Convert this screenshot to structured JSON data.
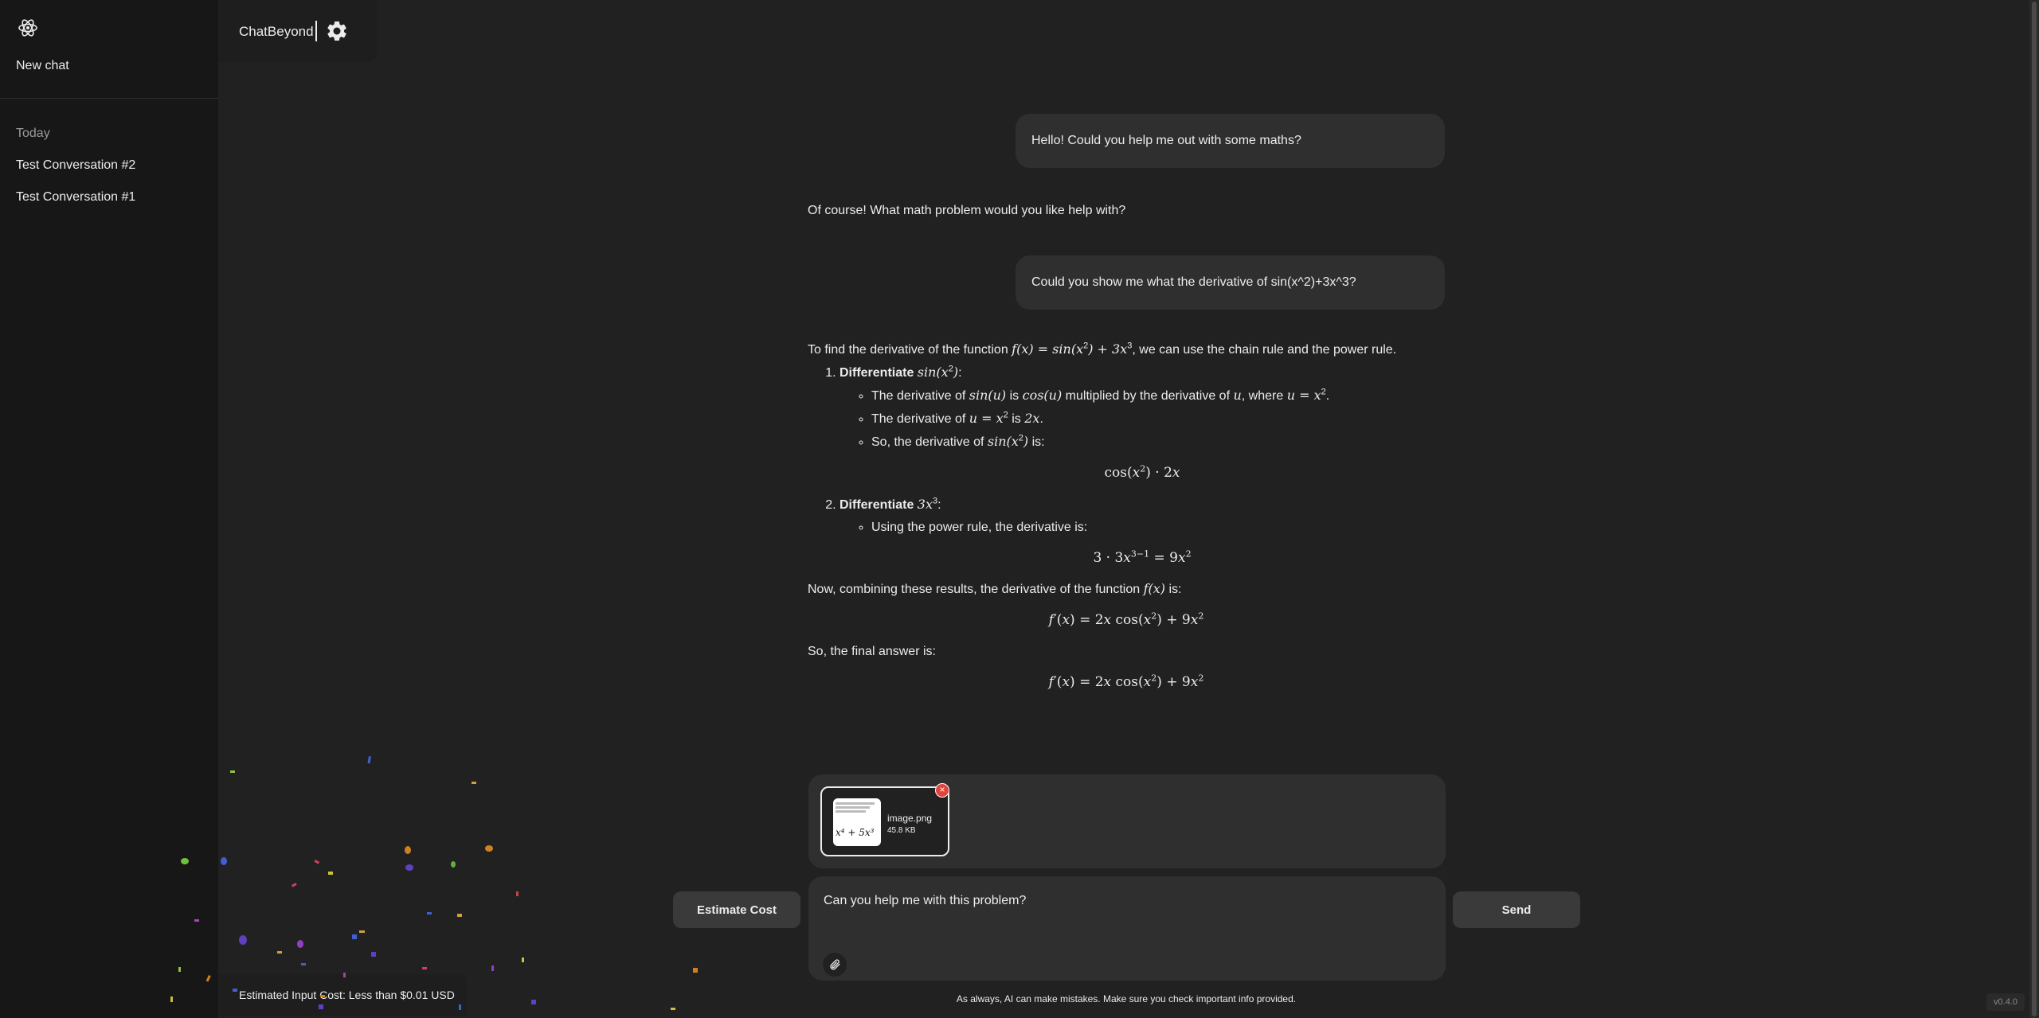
{
  "sidebar": {
    "logo_icon": "atom-icon",
    "new_chat_label": "New chat",
    "section_today": "Today",
    "conversations": [
      "Test Conversation #2",
      "Test Conversation #1"
    ]
  },
  "topbar": {
    "title": "ChatBeyond",
    "settings_icon": "gear-icon"
  },
  "messages": {
    "user_1": "Hello! Could you help me out with some maths?",
    "assistant_1": "Of course! What math problem would you like help with?",
    "user_2": "Could you show me what the derivative of sin(x^2)+3x^3?",
    "assistant_2": {
      "intro_a": "To find the derivative of the function ",
      "intro_b": ", we can use the chain rule and the power rule.",
      "step1_title": "Differentiate ",
      "step1_b1_a": "The derivative of ",
      "step1_b1_b": " is ",
      "step1_b1_c": " multiplied by the derivative of ",
      "step1_b1_d": ", where ",
      "step1_b2_a": "The derivative of ",
      "step1_b2_b": " is ",
      "step1_b3_a": "So, the derivative of ",
      "step1_b3_b": " is:",
      "step2_title": "Differentiate ",
      "step2_b1": "Using the power rule, the derivative is:",
      "combine_a": "Now, combining these results, the derivative of the function ",
      "combine_b": " is:",
      "final": "So, the final answer is:"
    }
  },
  "attachment": {
    "filename": "image.png",
    "size": "45.8 KB",
    "thumb_expr": "x⁴ + 5x³"
  },
  "composer": {
    "estimate_label": "Estimate Cost",
    "input_value": "Can you help me with this problem?",
    "send_label": "Send",
    "attach_icon": "paperclip-icon"
  },
  "footer": {
    "disclaimer": "As always, AI can make mistakes. Make sure you check important info provided.",
    "cost_estimate": "Estimated Input Cost: Less than $0.01 USD",
    "version": "v0.4.0"
  },
  "colors": {
    "background": "#212121",
    "sidebar": "#171717",
    "bubble": "#2f2f2f",
    "remove_badge": "#e0443a"
  }
}
